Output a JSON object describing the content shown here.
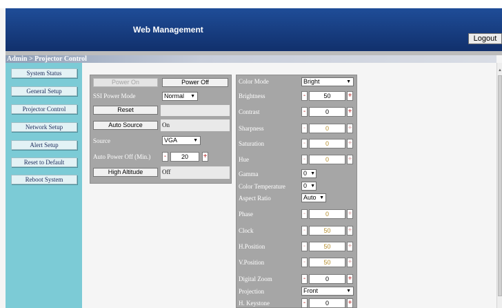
{
  "header": {
    "title": "Web Management",
    "logout_label": "Logout"
  },
  "breadcrumb": "Admin > Projector Control",
  "sidebar": {
    "items": [
      {
        "label": "System Status"
      },
      {
        "label": "General Setup"
      },
      {
        "label": "Projector Control"
      },
      {
        "label": "Network Setup"
      },
      {
        "label": "Alert Setup"
      },
      {
        "label": "Reset to Default"
      },
      {
        "label": "Reboot System"
      }
    ]
  },
  "left_panel": {
    "power_on_label": "Power On",
    "power_off_label": "Power Off",
    "ssi_power_mode_label": "SSI Power Mode",
    "ssi_power_mode_value": "Normal",
    "reset_label": "Reset",
    "auto_source_label": "Auto Source",
    "auto_source_value": "On",
    "source_label": "Source",
    "source_value": "VGA",
    "auto_power_off_label": "Auto Power Off (Min.)",
    "auto_power_off_value": "20",
    "high_altitude_label": "High Altitude",
    "high_altitude_value": "Off"
  },
  "right_panel": {
    "color_mode_label": "Color Mode",
    "color_mode_value": "Bright",
    "brightness_label": "Brightness",
    "brightness_value": "50",
    "contrast_label": "Contrast",
    "contrast_value": "0",
    "sharpness_label": "Sharpness",
    "sharpness_value": "0",
    "saturation_label": "Saturation",
    "saturation_value": "0",
    "hue_label": "Hue",
    "hue_value": "0",
    "gamma_label": "Gamma",
    "gamma_value": "0",
    "color_temperature_label": "Color Temperature",
    "color_temperature_value": "0",
    "aspect_ratio_label": "Aspect Ratio",
    "aspect_ratio_value": "Auto",
    "phase_label": "Phase",
    "phase_value": "0",
    "clock_label": "Clock",
    "clock_value": "50",
    "h_position_label": "H.Position",
    "h_position_value": "50",
    "v_position_label": "V.Position",
    "v_position_value": "50",
    "digital_zoom_label": "Digital Zoom",
    "digital_zoom_value": "0",
    "projection_label": "Projection",
    "projection_value": "Front",
    "h_keystone_label": "H. Keystone",
    "h_keystone_value": "0"
  },
  "symbols": {
    "minus": "-",
    "plus": "+",
    "dropdown": "▼",
    "scroll_up": "▲"
  },
  "colors": {
    "header_blue": "#1a3f84",
    "sidebar_teal": "#7ccbd6",
    "panel_grey": "#a6a6a6"
  }
}
